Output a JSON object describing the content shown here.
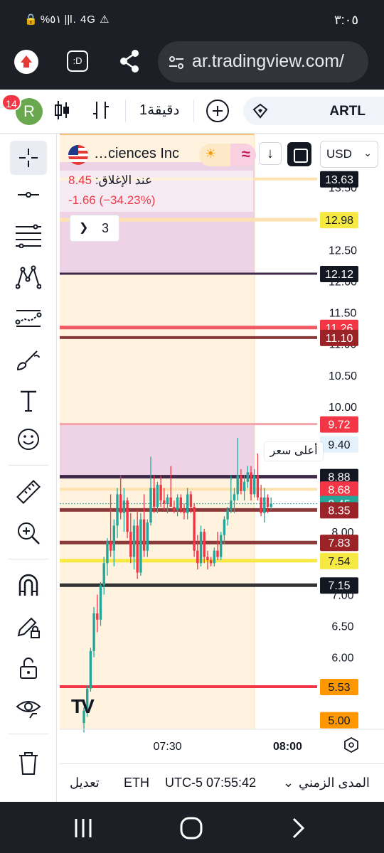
{
  "status_bar": {
    "time": "٣:٠٥",
    "icons": "🔒 %٥١ ||l. 4G ⚠"
  },
  "browser": {
    "url": "ar.tradingview.com/",
    "tabs_label": ":D"
  },
  "toolbar": {
    "avatar_letter": "R",
    "notification_count": "14",
    "interval": "1دقيقة",
    "symbol": "ARTL"
  },
  "legend": {
    "symbol_name": "…ciences Inc",
    "close_label": "عند الإغلاق: ",
    "close_value": "8.45",
    "change": "-1.66 (−34.23%)",
    "indicator_count": "3",
    "currency": "USD",
    "highest_label": "أعلى سعر"
  },
  "bottom_bar": {
    "edit": "تعديل",
    "exchange": "ETH",
    "time": "UTC-5 07:55:42",
    "range": "المدى الزمني"
  },
  "colors": {
    "up": "#26a69a",
    "down": "#f23645",
    "session_bg": "#fff3e0",
    "zone_purple": "#e1bee7"
  },
  "chart_data": {
    "type": "candlestick",
    "ylim": [
      4.85,
      13.9
    ],
    "y_ticks": [
      5.0,
      5.5,
      6.0,
      6.5,
      7.0,
      7.5,
      8.0,
      8.5,
      9.0,
      9.5,
      10.0,
      10.5,
      11.0,
      11.5,
      12.0,
      12.5,
      13.0,
      13.5
    ],
    "y_tick_labels": [
      "",
      "",
      "6.00",
      "6.50",
      "7.00",
      "",
      "8.00",
      "",
      "",
      "",
      "10.00",
      "10.50",
      "11.00",
      "11.50",
      "12.00",
      "12.50",
      "",
      "13.50"
    ],
    "x_ticks": [
      {
        "index": 25,
        "label": "07:30"
      },
      {
        "index": 55,
        "label": "08:00"
      }
    ],
    "last_price": 8.45,
    "highest_label_value": 9.4,
    "zones": [
      {
        "from": 12.12,
        "to": 13.9,
        "color": "#e1bee7"
      },
      {
        "from": 8.88,
        "to": 9.72,
        "color": "#e1bee7"
      }
    ],
    "levels": [
      {
        "value": 13.63,
        "label": "13.63",
        "bg": "#131722",
        "fg": "#ffffff",
        "line": "#fde2b0",
        "width": 4
      },
      {
        "value": 12.98,
        "label": "12.98",
        "bg": "#f5e942",
        "fg": "#131722",
        "line": "#fde2b0",
        "width": 5
      },
      {
        "value": 12.12,
        "label": "12.12",
        "bg": "#131722",
        "fg": "#ffffff",
        "line": "#3f2a4a",
        "width": 3
      },
      {
        "value": 11.26,
        "label": "11.26",
        "bg": "#f23645",
        "fg": "#ffffff",
        "line": "#f05a64",
        "width": 5
      },
      {
        "value": 11.1,
        "label": "11.10",
        "bg": "#9b2226",
        "fg": "#ffffff",
        "line": "#8b3a3a",
        "width": 4
      },
      {
        "value": 9.72,
        "label": "9.72",
        "bg": "#f23645",
        "fg": "#ffffff",
        "line": "#f5a3a8",
        "width": 3
      },
      {
        "value": 9.4,
        "label": "9.40",
        "bg": "#e3f2fd",
        "fg": "#131722",
        "line": "none",
        "width": 0
      },
      {
        "value": 8.88,
        "label": "8.88",
        "bg": "#131722",
        "fg": "#ffffff",
        "line": "#3f2a4a",
        "width": 5
      },
      {
        "value": 8.68,
        "label": "8.68",
        "bg": "#f23645",
        "fg": "#ffffff",
        "line": "#fde2b0",
        "width": 4
      },
      {
        "value": 8.45,
        "label": "8.45",
        "bg": "#26a69a",
        "fg": "#ffffff",
        "line": "dotted",
        "width": 1
      },
      {
        "value": 8.35,
        "label": "8.35",
        "bg": "#9b2226",
        "fg": "#ffffff",
        "line": "#8b3a3a",
        "width": 5
      },
      {
        "value": 7.83,
        "label": "7.83",
        "bg": "#9b2226",
        "fg": "#ffffff",
        "line": "#8b3a3a",
        "width": 5
      },
      {
        "value": 7.54,
        "label": "7.54",
        "bg": "#f5e942",
        "fg": "#131722",
        "line": "#f5e942",
        "width": 5
      },
      {
        "value": 7.15,
        "label": "7.15",
        "bg": "#131722",
        "fg": "#ffffff",
        "line": "#333333",
        "width": 5
      },
      {
        "value": 5.53,
        "label": "5.53",
        "bg": "#ff9800",
        "fg": "#131722",
        "line": "#f23645",
        "width": 4
      },
      {
        "value": 5.0,
        "label": "5.00",
        "bg": "#ff9800",
        "fg": "#131722",
        "line": "none",
        "width": 0
      }
    ],
    "candles": [
      {
        "o": 4.95,
        "h": 5.2,
        "l": 4.8,
        "c": 5.15
      },
      {
        "o": 5.15,
        "h": 5.55,
        "l": 5.05,
        "c": 5.5
      },
      {
        "o": 5.5,
        "h": 6.15,
        "l": 5.45,
        "c": 6.1
      },
      {
        "o": 6.1,
        "h": 6.8,
        "l": 6.0,
        "c": 6.7
      },
      {
        "o": 6.7,
        "h": 7.0,
        "l": 6.4,
        "c": 6.6
      },
      {
        "o": 6.6,
        "h": 7.2,
        "l": 6.5,
        "c": 7.15
      },
      {
        "o": 7.15,
        "h": 7.6,
        "l": 7.0,
        "c": 7.5
      },
      {
        "o": 7.5,
        "h": 7.9,
        "l": 7.3,
        "c": 7.85
      },
      {
        "o": 7.85,
        "h": 8.6,
        "l": 7.6,
        "c": 7.7
      },
      {
        "o": 7.7,
        "h": 8.2,
        "l": 7.45,
        "c": 8.1
      },
      {
        "o": 8.1,
        "h": 8.7,
        "l": 7.9,
        "c": 8.6
      },
      {
        "o": 8.6,
        "h": 8.9,
        "l": 8.2,
        "c": 8.3
      },
      {
        "o": 8.3,
        "h": 8.7,
        "l": 8.0,
        "c": 8.5
      },
      {
        "o": 8.5,
        "h": 8.55,
        "l": 7.9,
        "c": 8.0
      },
      {
        "o": 8.0,
        "h": 8.3,
        "l": 7.5,
        "c": 7.6
      },
      {
        "o": 7.6,
        "h": 8.2,
        "l": 7.4,
        "c": 8.1
      },
      {
        "o": 8.1,
        "h": 8.35,
        "l": 7.25,
        "c": 7.35
      },
      {
        "o": 7.35,
        "h": 8.3,
        "l": 7.3,
        "c": 8.2
      },
      {
        "o": 8.2,
        "h": 8.6,
        "l": 7.6,
        "c": 7.7
      },
      {
        "o": 7.7,
        "h": 8.2,
        "l": 7.6,
        "c": 8.15
      },
      {
        "o": 8.15,
        "h": 9.2,
        "l": 8.1,
        "c": 8.7
      },
      {
        "o": 8.7,
        "h": 8.9,
        "l": 8.3,
        "c": 8.4
      },
      {
        "o": 8.4,
        "h": 8.8,
        "l": 8.3,
        "c": 8.75
      },
      {
        "o": 8.75,
        "h": 8.9,
        "l": 8.4,
        "c": 8.5
      },
      {
        "o": 8.5,
        "h": 8.7,
        "l": 8.35,
        "c": 8.45
      },
      {
        "o": 8.45,
        "h": 8.6,
        "l": 8.3,
        "c": 8.55
      },
      {
        "o": 8.55,
        "h": 9.05,
        "l": 8.5,
        "c": 8.4
      },
      {
        "o": 8.4,
        "h": 8.5,
        "l": 8.3,
        "c": 8.35
      },
      {
        "o": 8.35,
        "h": 8.6,
        "l": 8.25,
        "c": 8.55
      },
      {
        "o": 8.55,
        "h": 8.6,
        "l": 8.3,
        "c": 8.35
      },
      {
        "o": 8.35,
        "h": 8.45,
        "l": 8.2,
        "c": 8.3
      },
      {
        "o": 8.3,
        "h": 8.7,
        "l": 8.2,
        "c": 8.6
      },
      {
        "o": 8.6,
        "h": 8.65,
        "l": 8.3,
        "c": 8.4
      },
      {
        "o": 8.4,
        "h": 8.45,
        "l": 7.6,
        "c": 7.7
      },
      {
        "o": 7.7,
        "h": 7.95,
        "l": 7.4,
        "c": 7.5
      },
      {
        "o": 7.5,
        "h": 8.1,
        "l": 7.45,
        "c": 8.0
      },
      {
        "o": 8.0,
        "h": 8.05,
        "l": 7.5,
        "c": 7.6
      },
      {
        "o": 7.6,
        "h": 7.7,
        "l": 7.4,
        "c": 7.55
      },
      {
        "o": 7.55,
        "h": 7.6,
        "l": 7.45,
        "c": 7.5
      },
      {
        "o": 7.5,
        "h": 7.75,
        "l": 7.45,
        "c": 7.7
      },
      {
        "o": 7.7,
        "h": 8.0,
        "l": 7.55,
        "c": 7.6
      },
      {
        "o": 7.6,
        "h": 8.0,
        "l": 7.55,
        "c": 7.95
      },
      {
        "o": 7.95,
        "h": 8.25,
        "l": 7.8,
        "c": 8.2
      },
      {
        "o": 8.2,
        "h": 8.4,
        "l": 8.1,
        "c": 8.35
      },
      {
        "o": 8.35,
        "h": 8.9,
        "l": 8.3,
        "c": 8.5
      },
      {
        "o": 8.5,
        "h": 8.7,
        "l": 8.3,
        "c": 8.6
      },
      {
        "o": 8.6,
        "h": 9.5,
        "l": 8.5,
        "c": 8.9
      },
      {
        "o": 8.9,
        "h": 9.0,
        "l": 8.6,
        "c": 8.65
      },
      {
        "o": 8.65,
        "h": 8.9,
        "l": 8.5,
        "c": 8.8
      },
      {
        "o": 8.8,
        "h": 9.05,
        "l": 8.7,
        "c": 8.95
      },
      {
        "o": 8.95,
        "h": 9.05,
        "l": 8.5,
        "c": 8.6
      },
      {
        "o": 8.6,
        "h": 9.0,
        "l": 8.55,
        "c": 8.9
      },
      {
        "o": 8.9,
        "h": 9.25,
        "l": 8.5,
        "c": 8.55
      },
      {
        "o": 8.55,
        "h": 8.75,
        "l": 8.25,
        "c": 8.3
      },
      {
        "o": 8.3,
        "h": 8.7,
        "l": 8.15,
        "c": 8.55
      },
      {
        "o": 8.55,
        "h": 8.6,
        "l": 8.3,
        "c": 8.4
      },
      {
        "o": 8.4,
        "h": 8.55,
        "l": 8.35,
        "c": 8.45
      }
    ]
  }
}
